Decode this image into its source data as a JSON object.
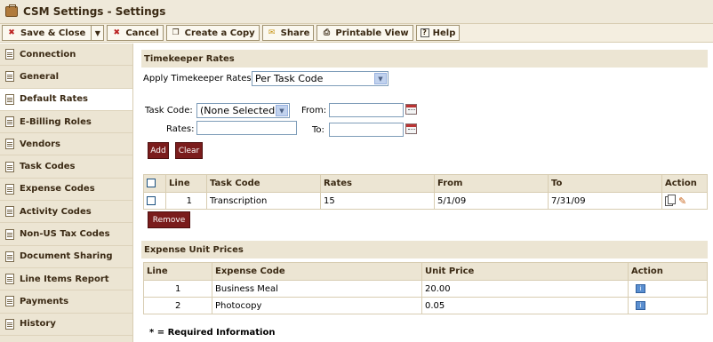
{
  "window": {
    "title": "CSM Settings - Settings"
  },
  "toolbar": {
    "save_close": "Save & Close",
    "cancel": "Cancel",
    "create_copy": "Create a Copy",
    "share": "Share",
    "printable_view": "Printable View",
    "help": "Help"
  },
  "sidebar": {
    "items": [
      {
        "label": "Connection"
      },
      {
        "label": "General"
      },
      {
        "label": "Default Rates",
        "active": true
      },
      {
        "label": "E-Billing Roles"
      },
      {
        "label": "Vendors"
      },
      {
        "label": "Task Codes"
      },
      {
        "label": "Expense Codes"
      },
      {
        "label": "Activity Codes"
      },
      {
        "label": "Non-US Tax Codes"
      },
      {
        "label": "Document Sharing"
      },
      {
        "label": "Line Items Report"
      },
      {
        "label": "Payments"
      },
      {
        "label": "History"
      }
    ]
  },
  "timekeeper": {
    "header": "Timekeeper Rates",
    "apply_label": "Apply Timekeeper Rates:",
    "apply_value": "Per Task Code",
    "task_code_label": "Task Code:",
    "task_code_value": "(None Selected)",
    "rates_label": "Rates:",
    "from_label": "From:",
    "to_label": "To:",
    "add_button": "Add",
    "clear_button": "Clear",
    "remove_button": "Remove",
    "columns": [
      "Line",
      "Task Code",
      "Rates",
      "From",
      "To",
      "Action"
    ],
    "rows": [
      {
        "line": "1",
        "task_code": "Transcription",
        "rates": "15",
        "from": "5/1/09",
        "to": "7/31/09"
      }
    ]
  },
  "expense": {
    "header": "Expense Unit Prices",
    "columns": [
      "Line",
      "Expense Code",
      "Unit Price",
      "Action"
    ],
    "rows": [
      {
        "line": "1",
        "expense_code": "Business Meal",
        "unit_price": "20.00"
      },
      {
        "line": "2",
        "expense_code": "Photocopy",
        "unit_price": "0.05"
      }
    ]
  },
  "required_note": "* = Required Information",
  "colors": {
    "button_red": "#7a1c1c",
    "header_bg": "#ece5d3"
  }
}
